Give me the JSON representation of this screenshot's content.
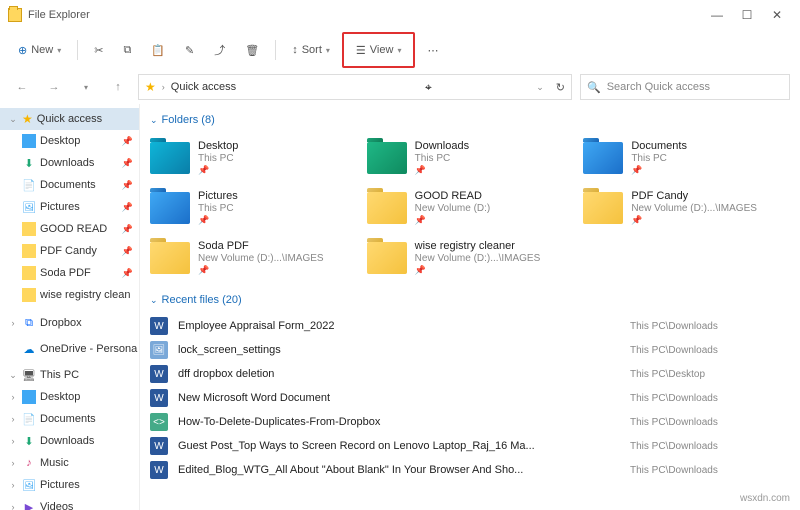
{
  "window": {
    "title": "File Explorer"
  },
  "toolbar": {
    "new": "New",
    "sort": "Sort",
    "view": "View"
  },
  "address": {
    "path": "Quick access",
    "search_placeholder": "Search Quick access"
  },
  "sidebar": {
    "quick_access": "Quick access",
    "items": [
      {
        "label": "Desktop"
      },
      {
        "label": "Downloads"
      },
      {
        "label": "Documents"
      },
      {
        "label": "Pictures"
      },
      {
        "label": "GOOD READ"
      },
      {
        "label": "PDF Candy"
      },
      {
        "label": "Soda PDF"
      },
      {
        "label": "wise registry clean"
      }
    ],
    "dropbox": "Dropbox",
    "onedrive": "OneDrive - Persona",
    "this_pc": "This PC",
    "pc_items": [
      {
        "label": "Desktop"
      },
      {
        "label": "Documents"
      },
      {
        "label": "Downloads"
      },
      {
        "label": "Music"
      },
      {
        "label": "Pictures"
      },
      {
        "label": "Videos"
      }
    ]
  },
  "sections": {
    "folders": "Folders (8)",
    "recent": "Recent files (20)"
  },
  "folders": [
    {
      "name": "Desktop",
      "loc": "This PC",
      "icon": "fi-blue",
      "pin": true
    },
    {
      "name": "Downloads",
      "loc": "This PC",
      "icon": "fi-green",
      "pin": true
    },
    {
      "name": "Documents",
      "loc": "This PC",
      "icon": "fi-bluef",
      "pin": true
    },
    {
      "name": "Pictures",
      "loc": "This PC",
      "icon": "fi-pic",
      "pin": true
    },
    {
      "name": "GOOD READ",
      "loc": "New Volume (D:)",
      "icon": "fi-yellow",
      "pin": true
    },
    {
      "name": "PDF Candy",
      "loc": "New Volume (D:)...\\IMAGES",
      "icon": "fi-yellow",
      "pin": true
    },
    {
      "name": "Soda PDF",
      "loc": "New Volume (D:)...\\IMAGES",
      "icon": "fi-yellow",
      "pin": true
    },
    {
      "name": "wise registry cleaner",
      "loc": "New Volume (D:)...\\IMAGES",
      "icon": "fi-yellow",
      "pin": true
    }
  ],
  "files": [
    {
      "name": "Employee Appraisal Form_2022",
      "loc": "This PC\\Downloads",
      "icon": "fi-word"
    },
    {
      "name": "lock_screen_settings",
      "loc": "This PC\\Downloads",
      "icon": "fi-img"
    },
    {
      "name": "dff dropbox deletion",
      "loc": "This PC\\Desktop",
      "icon": "fi-word"
    },
    {
      "name": "New Microsoft Word Document",
      "loc": "This PC\\Downloads",
      "icon": "fi-word"
    },
    {
      "name": "How-To-Delete-Duplicates-From-Dropbox",
      "loc": "This PC\\Downloads",
      "icon": "fi-html"
    },
    {
      "name": "Guest Post_Top Ways to Screen Record on Lenovo Laptop_Raj_16 Ma...",
      "loc": "This PC\\Downloads",
      "icon": "fi-word"
    },
    {
      "name": "Edited_Blog_WTG_All About \"About Blank\" In Your Browser And Sho...",
      "loc": "This PC\\Downloads",
      "icon": "fi-word"
    }
  ],
  "watermark": "wsxdn.com"
}
